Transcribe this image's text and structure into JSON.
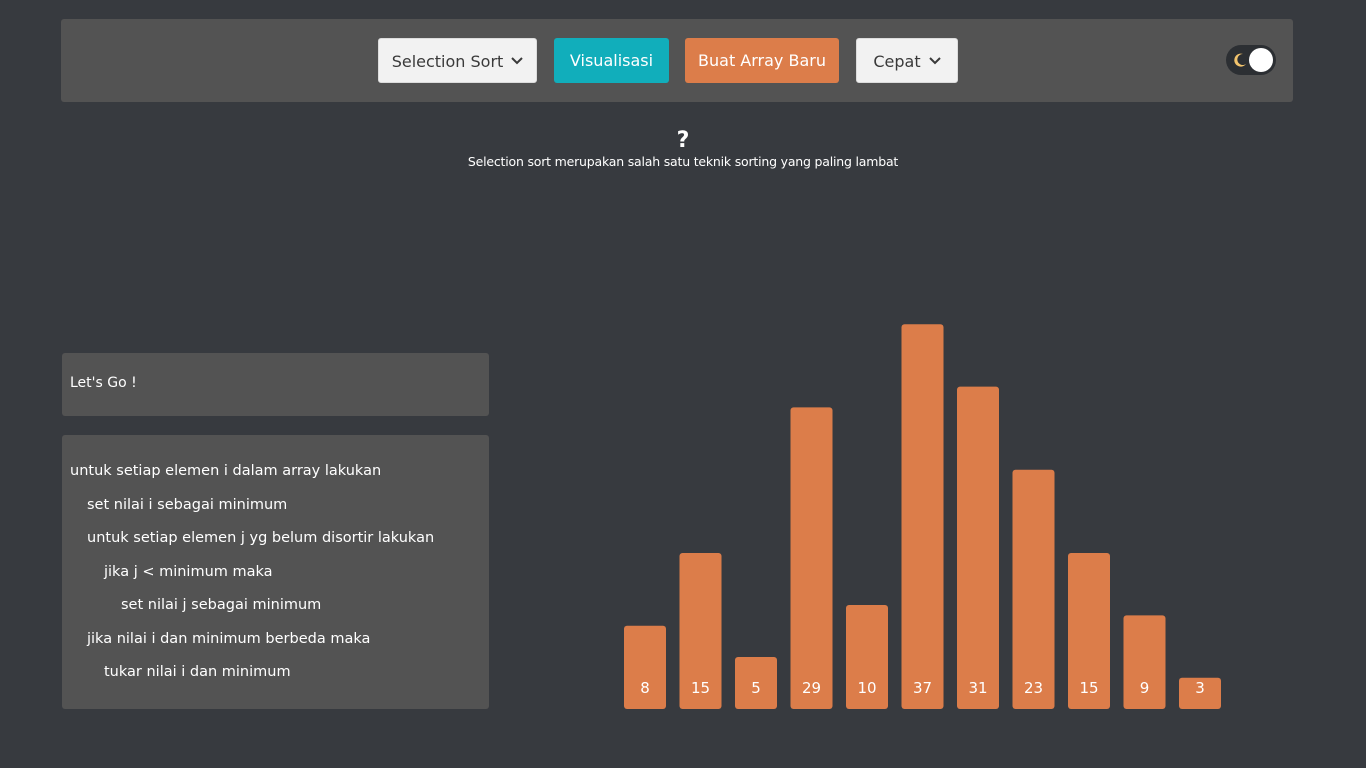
{
  "navbar": {
    "algorithm_select": "Selection Sort",
    "visualize_label": "Visualisasi",
    "new_array_label": "Buat Array Baru",
    "speed_select": "Cepat",
    "theme_toggle": "dark"
  },
  "help": {
    "icon_text": "?",
    "description": "Selection sort merupakan salah satu teknik sorting yang paling lambat"
  },
  "status": {
    "message": "Let's Go !"
  },
  "pseudocode": [
    "untuk setiap elemen i dalam array lakukan",
    "set nilai i sebagai minimum",
    "untuk setiap elemen j yg belum disortir lakukan",
    "jika j < minimum maka",
    "set nilai j sebagai minimum",
    "jika nilai i dan minimum berbeda maka",
    "tukar nilai i dan minimum"
  ],
  "colors": {
    "background": "#373a3f",
    "panel": "#535353",
    "accent_teal": "#11aebb",
    "accent_orange": "#dc7d4a",
    "bar": "#dc7d4a"
  },
  "chart_data": {
    "type": "bar",
    "categories": [
      "8",
      "15",
      "5",
      "29",
      "10",
      "37",
      "31",
      "23",
      "15",
      "9",
      "3"
    ],
    "values": [
      8,
      15,
      5,
      29,
      10,
      37,
      31,
      23,
      15,
      9,
      3
    ],
    "title": "",
    "xlabel": "",
    "ylabel": "",
    "ylim": [
      0,
      37
    ]
  }
}
